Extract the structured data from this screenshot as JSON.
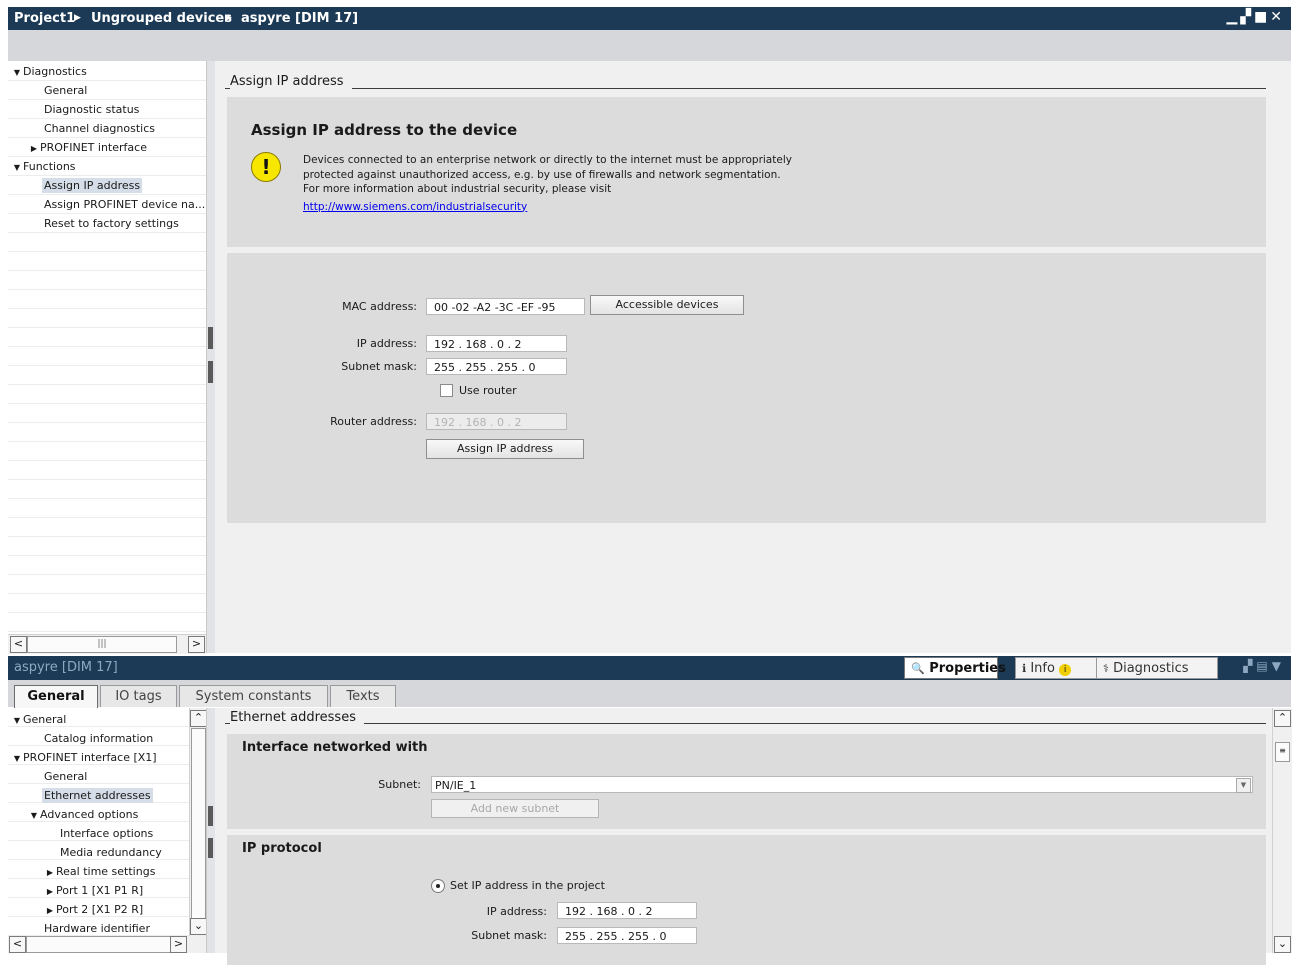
{
  "window": {
    "breadcrumb": [
      "Project1",
      "Ungrouped devices",
      "aspyre [DIM 17]"
    ],
    "controls": [
      "minimize-icon",
      "restore-icon",
      "maximize-icon",
      "close-icon"
    ]
  },
  "upper_tree": {
    "items": [
      {
        "label": "Diagnostics",
        "level": 0,
        "arrow": "expanded"
      },
      {
        "label": "General",
        "level": 1,
        "arrow": "none"
      },
      {
        "label": "Diagnostic status",
        "level": 1,
        "arrow": "none"
      },
      {
        "label": "Channel diagnostics",
        "level": 1,
        "arrow": "none"
      },
      {
        "label": "PROFINET interface",
        "level": 1,
        "arrow": "collapsed"
      },
      {
        "label": "Functions",
        "level": 0,
        "arrow": "expanded"
      },
      {
        "label": "Assign IP address",
        "level": 1,
        "arrow": "none",
        "selected": true
      },
      {
        "label": "Assign PROFINET device na...",
        "level": 1,
        "arrow": "none"
      },
      {
        "label": "Reset to factory settings",
        "level": 1,
        "arrow": "none"
      }
    ]
  },
  "assign_ip": {
    "section_title": "Assign IP address",
    "panel_title": "Assign IP address to the device",
    "warning_lines": [
      "Devices connected to an enterprise network or directly to the internet must be appropriately",
      "protected against unauthorized access, e.g. by use of firewalls and network segmentation.",
      "For more information about industrial security, please visit"
    ],
    "warning_link": "http://www.siemens.com/industrialsecurity",
    "mac_label": "MAC address:",
    "mac_value": "00 -02 -A2 -3C -EF -95",
    "accessible_devices_button": "Accessible devices",
    "ip_label": "IP address:",
    "ip_value": "192 . 168 . 0    . 2",
    "subnet_label": "Subnet mask:",
    "subnet_value": "255 . 255 . 255 . 0",
    "use_router_label": "Use router",
    "use_router_checked": false,
    "router_label": "Router address:",
    "router_value": "192 . 168 . 0    . 2",
    "assign_button": "Assign IP address"
  },
  "inspector": {
    "title": "aspyre [DIM 17]",
    "tabs": [
      {
        "label": "Properties",
        "icon": "properties-icon",
        "active": true
      },
      {
        "label": "Info",
        "icon": "info-icon",
        "badge_icon": "info-badge-icon",
        "active": false
      },
      {
        "label": "Diagnostics",
        "icon": "diagnostics-icon",
        "active": false
      }
    ],
    "subtabs": [
      "General",
      "IO tags",
      "System constants",
      "Texts"
    ],
    "active_subtab": "General"
  },
  "lower_tree": {
    "items": [
      {
        "label": "General",
        "level": 0,
        "arrow": "expanded"
      },
      {
        "label": "Catalog information",
        "level": 1,
        "arrow": "none"
      },
      {
        "label": "PROFINET interface [X1]",
        "level": 0,
        "arrow": "expanded"
      },
      {
        "label": "General",
        "level": 1,
        "arrow": "none"
      },
      {
        "label": "Ethernet addresses",
        "level": 1,
        "arrow": "none",
        "selected": true
      },
      {
        "label": "Advanced options",
        "level": 1,
        "arrow": "expanded"
      },
      {
        "label": "Interface options",
        "level": 2,
        "arrow": "none"
      },
      {
        "label": "Media redundancy",
        "level": 2,
        "arrow": "none"
      },
      {
        "label": "Real time settings",
        "level": 2,
        "arrow": "collapsed"
      },
      {
        "label": "Port 1 [X1 P1 R]",
        "level": 2,
        "arrow": "collapsed"
      },
      {
        "label": "Port 2 [X1 P2 R]",
        "level": 2,
        "arrow": "collapsed"
      },
      {
        "label": "Hardware identifier",
        "level": 1,
        "arrow": "none"
      }
    ]
  },
  "ethernet": {
    "section_title": "Ethernet addresses",
    "networked_title": "Interface networked with",
    "subnet_label": "Subnet:",
    "subnet_value": "PN/IE_1",
    "add_subnet_button": "Add new subnet",
    "ip_protocol_title": "IP protocol",
    "set_ip_label": "Set IP address in the project",
    "ip_label": "IP address:",
    "ip_value": "192 . 168 . 0    . 2",
    "subnet_mask_label": "Subnet mask:",
    "subnet_mask_value": "255 . 255 . 255 . 0"
  },
  "colors": {
    "titlebar": "#1c3a55",
    "panel": "#dcdcdc",
    "link": "#0000ee",
    "warning_yellow": "#f7e600"
  }
}
